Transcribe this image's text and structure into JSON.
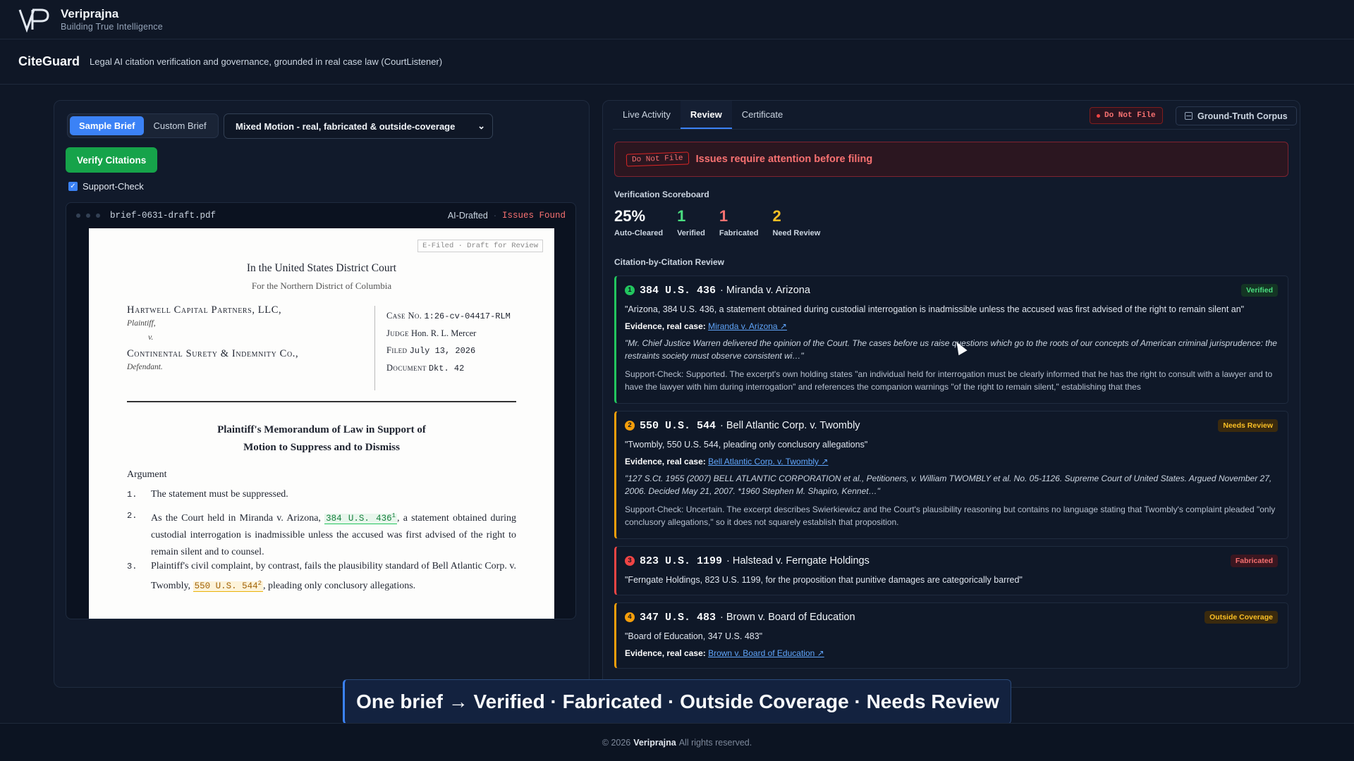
{
  "brand": {
    "name": "Veriprajna",
    "tagline": "Building True Intelligence",
    "logo_icon": "vp-logo-icon"
  },
  "app": {
    "title": "CiteGuard",
    "description": "Legal AI citation verification and governance, grounded in real case law (CourtListener)"
  },
  "left": {
    "seg_sample": "Sample Brief",
    "seg_custom": "Custom Brief",
    "select_value": "Mixed Motion - real, fabricated & outside-coverage",
    "verify_button": "Verify Citations",
    "support_check": "Support-Check",
    "support_checked": true,
    "viewer": {
      "filename": "brief-0631-draft.pdf",
      "ai_drafted": "AI-Drafted",
      "sep": "·",
      "issues": "Issues Found"
    },
    "doc": {
      "efiled": "E-Filed · Draft for Review",
      "court": "In the United States District Court",
      "district": "For the Northern District of Columbia",
      "plaintiff": "Hartwell Capital Partners, LLC,",
      "plaintiff_role": "Plaintiff,",
      "vs": "v.",
      "defendant": "Continental Surety & Indemnity Co.,",
      "defendant_role": "Defendant.",
      "case_no_label": "Case No.",
      "case_no": "1:26-cv-04417-RLM",
      "judge_label": "Judge",
      "judge": "Hon. R. L. Mercer",
      "filed_label": "Filed",
      "filed": "July 13, 2026",
      "document_label": "Document",
      "document": "Dkt. 42",
      "memo_title_1": "Plaintiff's Memorandum of Law in Support of",
      "memo_title_2": "Motion to Suppress and to Dismiss",
      "argument": "Argument",
      "p1_num": "1.",
      "p1": "The statement must be suppressed.",
      "p2_num": "2.",
      "p2_a": "As the Court held in Miranda v. Arizona, ",
      "p2_cite": "384 U.S. 436",
      "p2_cite_mark": "1",
      "p2_b": ", a statement obtained during custodial interrogation is inadmissible unless the accused was first advised of the right to remain silent and to counsel.",
      "p3_num": "3.",
      "p3_a": "Plaintiff's civil complaint, by contrast, fails the plausibility standard of Bell Atlantic Corp. v. Twombly, ",
      "p3_cite": "550 U.S. 544",
      "p3_cite_mark": "2",
      "p3_b": ", pleading only conclusory allegations."
    }
  },
  "right": {
    "tabs": [
      "Live Activity",
      "Review",
      "Certificate"
    ],
    "active_tab": "Review",
    "dnf_badge": "Do Not File",
    "corpus_button": "Ground-Truth Corpus",
    "alert_stamp": "Do Not File",
    "alert_message": "Issues require attention before filing",
    "scoreboard_label": "Verification Scoreboard",
    "scores": [
      {
        "value": "25%",
        "label": "Auto-Cleared",
        "color": "#f8fafc"
      },
      {
        "value": "1",
        "label": "Verified",
        "color": "#4ade80"
      },
      {
        "value": "1",
        "label": "Fabricated",
        "color": "#f87171"
      },
      {
        "value": "2",
        "label": "Need Review",
        "color": "#fbbf24"
      }
    ],
    "review_label": "Citation-by-Citation Review",
    "evidence_label": "Evidence, real case:",
    "citations": [
      {
        "n": "1",
        "cite": "384 U.S. 436",
        "case": "· Miranda v. Arizona",
        "status": "Verified",
        "color": "#22c55e",
        "quote": "\"Arizona, 384 U.S. 436, a statement obtained during custodial interrogation is inadmissible unless the accused was first advised of the right to remain silent an\"",
        "evidence_link": "Miranda v. Arizona ↗",
        "excerpt": "\"Mr. Chief Justice Warren delivered the opinion of the Court. The cases before us raise questions which go to the roots of our concepts of American criminal jurisprudence: the restraints society must observe consistent wi…\"",
        "support": "Support-Check: Supported. The excerpt's own holding states \"an individual held for interrogation must be clearly informed that he has the right to consult with a lawyer and to have the lawyer with him during interrogation\" and references the companion warnings \"of the right to remain silent,\" establishing that thes"
      },
      {
        "n": "2",
        "cite": "550 U.S. 544",
        "case": "· Bell Atlantic Corp. v. Twombly",
        "status": "Needs Review",
        "color": "#f59e0b",
        "quote": "\"Twombly, 550 U.S. 544, pleading only conclusory allegations\"",
        "evidence_link": "Bell Atlantic Corp. v. Twombly ↗",
        "excerpt": "\"127 S.Ct. 1955 (2007) BELL ATLANTIC CORPORATION et al., Petitioners, v. William TWOMBLY et al. No. 05-1126. Supreme Court of United States. Argued November 27, 2006. Decided May 21, 2007. *1960 Stephen M. Shapiro, Kennet…\"",
        "support": "Support-Check: Uncertain. The excerpt describes Swierkiewicz and the Court's plausibility reasoning but contains no language stating that Twombly's complaint pleaded \"only conclusory allegations,\" so it does not squarely establish that proposition."
      },
      {
        "n": "3",
        "cite": "823 U.S. 1199",
        "case": "· Halstead v. Ferngate Holdings",
        "status": "Fabricated",
        "color": "#ef4444",
        "quote": "\"Ferngate Holdings, 823 U.S. 1199, for the proposition that punitive damages are categorically barred\""
      },
      {
        "n": "4",
        "cite": "347 U.S. 483",
        "case": "· Brown v. Board of Education",
        "status": "Outside Coverage",
        "color": "#f59e0b",
        "quote": "\"Board of Education, 347 U.S. 483\"",
        "evidence_link": "Brown v. Board of Education ↗"
      }
    ]
  },
  "banner": "One brief → Verified · Fabricated · Outside Coverage · Needs Review",
  "footer": {
    "prefix": "© 2026",
    "brand": "Veriprajna",
    "suffix": "All rights reserved."
  }
}
